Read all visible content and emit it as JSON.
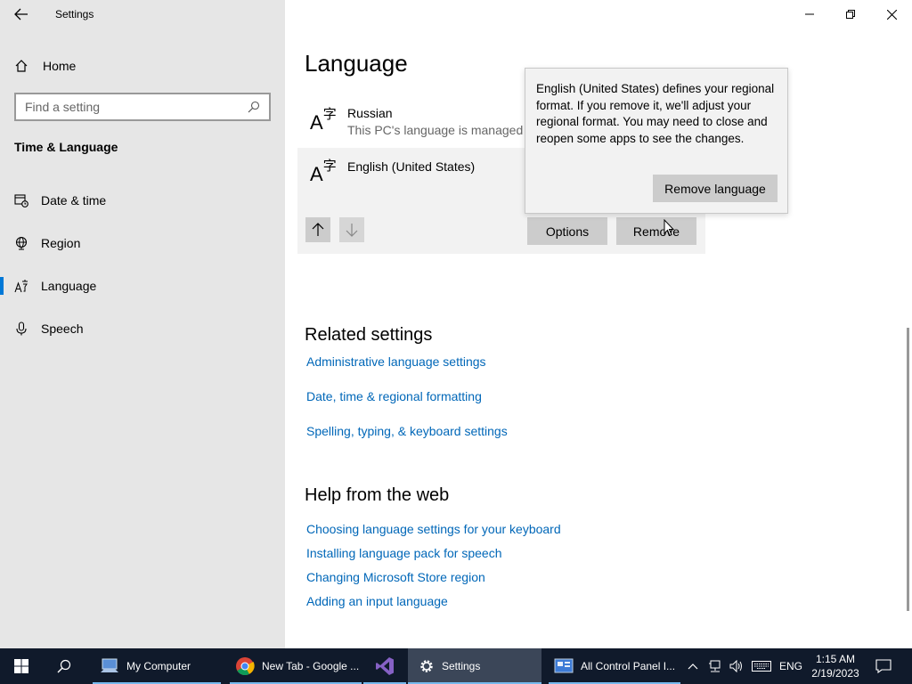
{
  "window": {
    "app_title": "Settings",
    "back_icon": "back-arrow-icon"
  },
  "sidebar": {
    "home_label": "Home",
    "search_placeholder": "Find a setting",
    "section_title": "Time & Language",
    "items": [
      {
        "label": "Date & time",
        "icon": "calendar-clock-icon"
      },
      {
        "label": "Region",
        "icon": "globe-icon"
      },
      {
        "label": "Language",
        "icon": "language-icon",
        "active": true
      },
      {
        "label": "Speech",
        "icon": "microphone-icon"
      }
    ]
  },
  "main": {
    "title": "Language",
    "languages": [
      {
        "name": "Russian",
        "subtitle": "This PC's language is managed b"
      },
      {
        "name": "English (United States)"
      }
    ],
    "options_label": "Options",
    "remove_label": "Remove"
  },
  "flyout": {
    "text": "English (United States) defines your regional format. If you remove it, we'll adjust your regional format. You may need to close and reopen some apps to see the changes.",
    "button_label": "Remove language"
  },
  "related": {
    "title": "Related settings",
    "links": [
      "Administrative language settings",
      "Date, time & regional formatting",
      "Spelling, typing, & keyboard settings"
    ]
  },
  "help": {
    "title": "Help from the web",
    "links": [
      "Choosing language settings for your keyboard",
      "Installing language pack for speech",
      "Changing Microsoft Store region",
      "Adding an input language"
    ]
  },
  "taskbar": {
    "apps": [
      {
        "label": "My Computer"
      },
      {
        "label": "New Tab - Google ..."
      },
      {
        "label": ""
      },
      {
        "label": "Settings"
      },
      {
        "label": "All Control Panel I..."
      }
    ],
    "input_lang": "ENG",
    "time": "1:15 AM",
    "date": "2/19/2023"
  },
  "colors": {
    "accent": "#0078d7",
    "link": "#0067b8",
    "taskbar": "#101a2b"
  }
}
